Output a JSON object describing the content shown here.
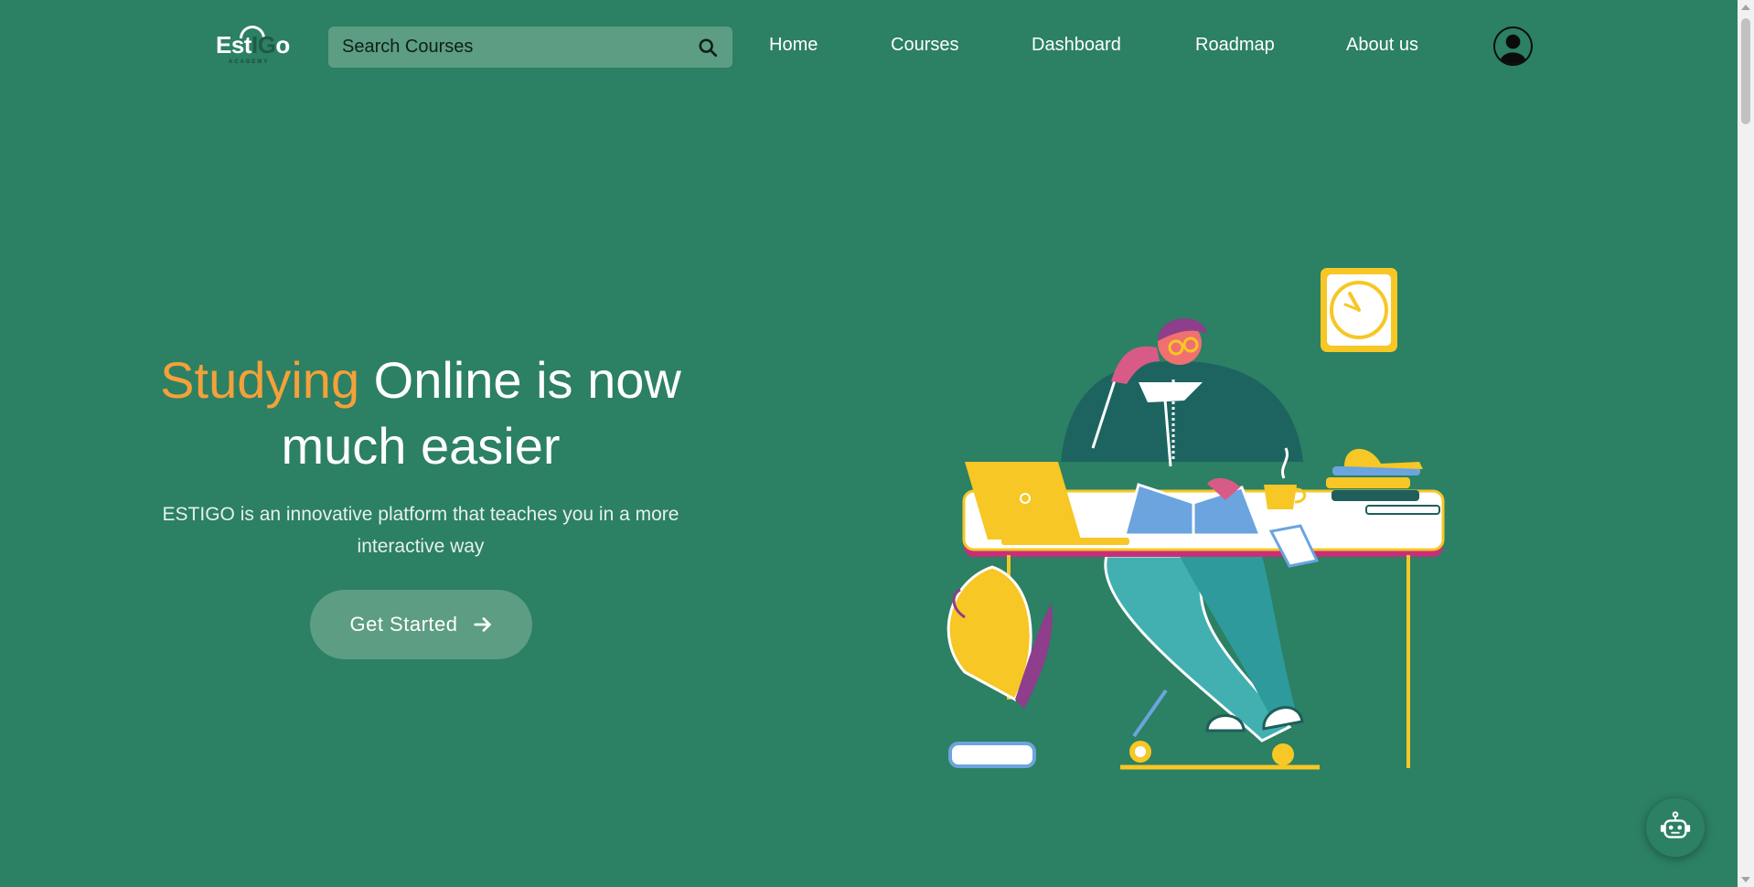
{
  "brand": {
    "logo_main": "Est",
    "logo_accent": "IG",
    "logo_end": "o",
    "logo_sub": "ACADEMY",
    "colors": {
      "background": "#2c8063",
      "accent": "#f5a03a",
      "button": "#5c9d83"
    }
  },
  "search": {
    "placeholder": "Search Courses",
    "value": "",
    "icon": "search-icon"
  },
  "nav": {
    "items": [
      {
        "label": "Home"
      },
      {
        "label": "Courses"
      },
      {
        "label": "Dashboard"
      },
      {
        "label": "Roadmap"
      },
      {
        "label": "About us"
      }
    ]
  },
  "user": {
    "icon": "user-avatar-icon"
  },
  "hero": {
    "title_accent": "Studying",
    "title_rest": " Online is now much easier",
    "description": "ESTIGO is an innovative platform that teaches you in a more interactive way",
    "cta_label": "Get Started",
    "cta_icon": "arrow-right-icon",
    "illustration": "person-studying-at-desk-illustration"
  },
  "chatbot": {
    "icon": "robot-icon"
  }
}
